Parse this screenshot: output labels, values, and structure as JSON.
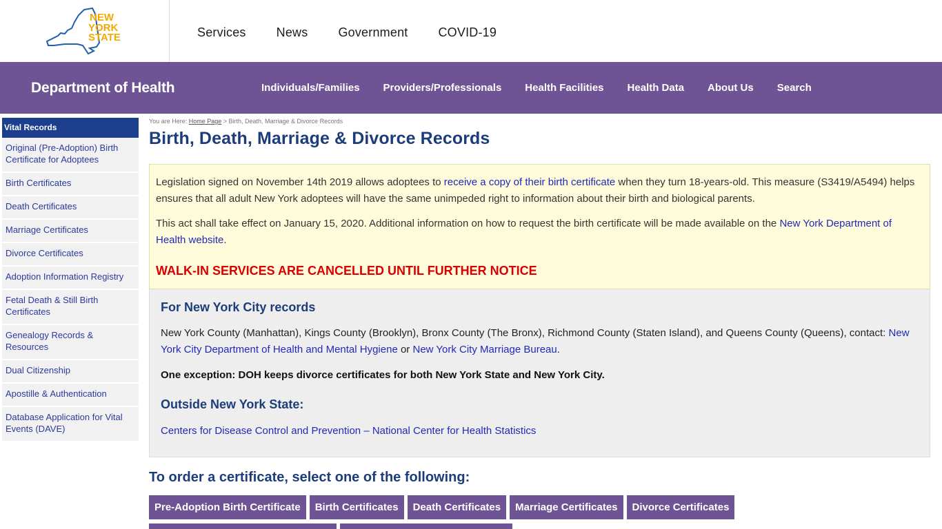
{
  "logo": {
    "line1": "NEW",
    "line2": "YORK",
    "line3": "STATE"
  },
  "state_nav": [
    "Services",
    "News",
    "Government",
    "COVID-19"
  ],
  "agency": {
    "title": "Department of Health",
    "nav": [
      "Individuals/Families",
      "Providers/Professionals",
      "Health Facilities",
      "Health Data",
      "About Us",
      "Search"
    ]
  },
  "sidebar": {
    "heading": "Vital Records",
    "items": [
      "Original (Pre-Adoption) Birth Certificate for Adoptees",
      "Birth Certificates",
      "Death Certificates",
      "Marriage Certificates",
      "Divorce Certificates",
      "Adoption Information Registry",
      "Fetal Death & Still Birth Certificates",
      "Genealogy Records & Resources",
      "Dual Citizenship",
      "Apostille & Authentication",
      "Database Application for Vital Events (DAVE)"
    ]
  },
  "breadcrumb": {
    "prefix": "You are Here: ",
    "home": "Home Page",
    "separator": " > ",
    "current": "Birth, Death, Marriage & Divorce Records"
  },
  "page_title": "Birth, Death, Marriage & Divorce Records",
  "notice": {
    "p1_before": "Legislation signed on November 14th 2019 allows adoptees to ",
    "p1_link": "receive a copy of their birth certificate",
    "p1_after": " when they turn 18-years-old. This measure (S3419/A5494) helps ensures that all adult New York adoptees will have the same unimpeded right to information about their birth and biological parents.",
    "p2_before": "This act shall take effect on January 15, 2020. Additional information on how to request the birth certificate will be made available on the ",
    "p2_link": "New York Department of Health website",
    "p2_after": ".",
    "alert": "WALK-IN SERVICES ARE CANCELLED UNTIL FURTHER NOTICE"
  },
  "nyc": {
    "heading": "For New York City records",
    "text": "New York County (Manhattan), Kings County (Brooklyn), Bronx County (The Bronx), Richmond County (Staten Island), and Queens County (Queens), contact: ",
    "link1": "New York City Department of Health and Mental Hygiene",
    "or": " or ",
    "link2": "New York City Marriage Bureau",
    "period": ".",
    "exception": "One exception: DOH keeps divorce certificates for both New York State and New York City.",
    "outside_heading": "Outside New York State:",
    "outside_link": "Centers for Disease Control and Prevention – National Center for Health Statistics"
  },
  "order": {
    "title": "To order a certificate, select one of the following:",
    "buttons": [
      "Pre-Adoption Birth Certificate",
      "Birth Certificates",
      "Death Certificates",
      "Marriage Certificates",
      "Divorce Certificates"
    ]
  },
  "colors": {
    "purple": "#6e5494",
    "navy": "#1c3d7a",
    "sidebar_head": "#1b3f8c",
    "alert_red": "#d80000",
    "notice_bg": "#fefcdb",
    "link": "#2229b5",
    "logo_orange": "#f2a900",
    "logo_blue": "#1f5fae"
  }
}
